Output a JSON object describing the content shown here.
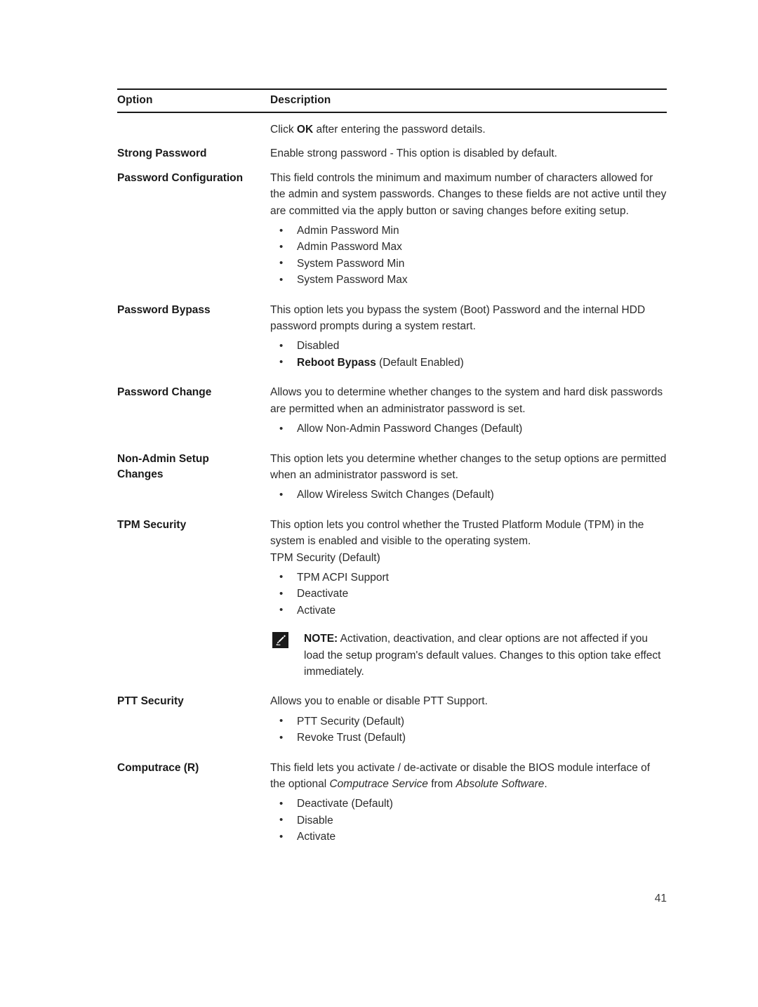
{
  "document": {
    "page_number": "41",
    "note_icon": "note-pencil-icon"
  },
  "table": {
    "headers": {
      "option": "Option",
      "description": "Description"
    },
    "rows": [
      {
        "option": "",
        "intro_prefix": "Click ",
        "intro_bold": "OK",
        "intro_suffix": " after entering the password details."
      },
      {
        "option": "Strong Password",
        "body": "Enable strong password - This option is disabled by default."
      },
      {
        "option": "Password Configuration",
        "body": "This field controls the minimum and maximum number of characters allowed for the admin and system passwords. Changes to these fields are not active until they are committed via the apply button or saving changes before exiting setup.",
        "bullets": [
          "Admin Password Min",
          "Admin Password Max",
          "System Password Min",
          "System Password Max"
        ]
      },
      {
        "option": "Password Bypass",
        "body": "This option lets you bypass the system (Boot) Password and the internal HDD password prompts during a system restart.",
        "bullets_plain": [
          "Disabled"
        ],
        "bullet_bold_label": "Reboot Bypass",
        "bullet_bold_tail": " (Default Enabled)"
      },
      {
        "option": "Password Change",
        "body": "Allows you to determine whether changes to the system and hard disk passwords are permitted when an administrator password is set.",
        "bullets": [
          "Allow Non-Admin Password Changes (Default)"
        ]
      },
      {
        "option_line1": "Non-Admin Setup",
        "option_line2": "Changes",
        "body": "This option lets you determine whether changes to the setup options are permitted when an administrator password is set.",
        "bullets": [
          "Allow Wireless Switch Changes (Default)"
        ]
      },
      {
        "option": "TPM Security",
        "body": "This option lets you control whether the Trusted Platform Module (TPM) in the system is enabled and visible to the operating system.",
        "body2": "TPM Security (Default)",
        "bullets": [
          "TPM ACPI Support",
          "Deactivate",
          "Activate"
        ],
        "note": {
          "label": "NOTE:",
          "text": " Activation, deactivation, and clear options are not affected if you load the setup program's default values. Changes to this option take effect immediately."
        }
      },
      {
        "option": "PTT Security",
        "body": "Allows you to enable or disable PTT Support.",
        "bullets": [
          "PTT Security (Default)",
          "Revoke Trust (Default)"
        ]
      },
      {
        "option": "Computrace (R)",
        "body_part1": "This field lets you activate / de-activate or disable the BIOS module interface of the optional ",
        "body_italic1": "Computrace Service",
        "body_part2": " from ",
        "body_italic2": "Absolute Software",
        "body_part3": ".",
        "bullets": [
          "Deactivate (Default)",
          "Disable",
          "Activate"
        ]
      }
    ]
  }
}
